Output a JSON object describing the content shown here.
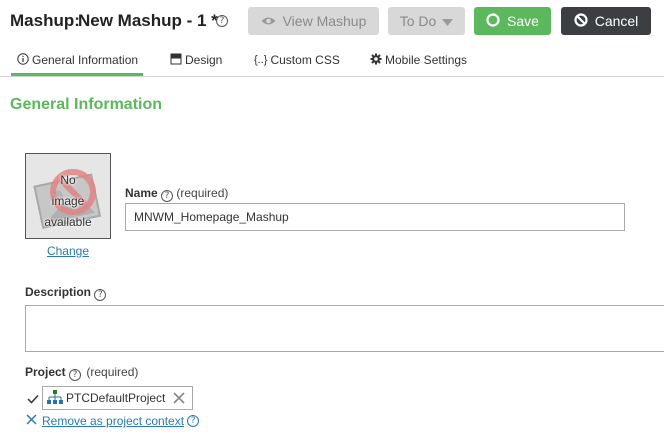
{
  "header": {
    "title_prefix": "Mashup:",
    "title_name": "New Mashup - 1 *"
  },
  "toolbar": {
    "view_label": "View Mashup",
    "todo_label": "To Do",
    "save_label": "Save",
    "cancel_label": "Cancel"
  },
  "tabs": [
    {
      "label": "General Information",
      "icon": "info-icon",
      "active": true
    },
    {
      "label": "Design",
      "icon": "design-icon"
    },
    {
      "label": "Custom CSS",
      "icon": "css-braces-icon"
    },
    {
      "label": "Mobile Settings",
      "icon": "gear-icon"
    }
  ],
  "section": {
    "title": "General Information"
  },
  "image": {
    "placeholder_lines": [
      "No",
      "image",
      "available"
    ],
    "change_label": "Change"
  },
  "name": {
    "label": "Name",
    "required": "(required)",
    "value": "MNWM_Homepage_Mashup"
  },
  "description": {
    "label": "Description",
    "value": ""
  },
  "project": {
    "label": "Project",
    "required": "(required)",
    "value": "PTCDefaultProject",
    "remove_label": "Remove as project context"
  },
  "colors": {
    "accent_green": "#5cb85c",
    "cancel_dark": "#3b3f42",
    "link_blue": "#2a7ab0",
    "disabled_gray": "#d8d8d8"
  }
}
